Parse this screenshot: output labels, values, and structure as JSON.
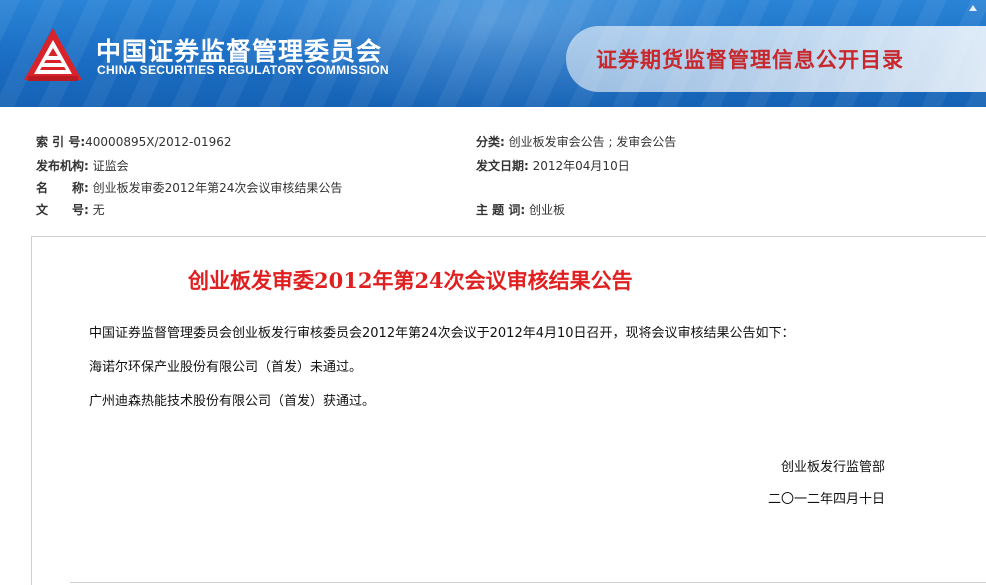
{
  "header": {
    "cn_title": "中国证券监督管理委员会",
    "en_title": "CHINA SECURITIES REGULATORY COMMISSION",
    "right_title": "证券期货监督管理信息公开目录",
    "logo": "csrc-logo-icon"
  },
  "meta": {
    "index_label": "索 引 号:",
    "index_value": "40000895X/2012-01962",
    "category_label": "分类:",
    "category_value": " 创业板发审会公告 ; 发审会公告",
    "issuer_label": "发布机构:",
    "issuer_value": " 证监会",
    "date_label": "发文日期:",
    "date_value": " 2012年04月10日",
    "name_label": "名　　称:",
    "name_value": " 创业板发审委2012年第24次会议审核结果公告",
    "docno_label": "文　　号:",
    "docno_value": " 无",
    "keyword_label": "主 题 词:",
    "keyword_value": " 创业板"
  },
  "document": {
    "title": "创业板发审委2012年第24次会议审核结果公告",
    "paragraphs": [
      "中国证券监督管理委员会创业板发行审核委员会2012年第24次会议于2012年4月10日召开，现将会议审核结果公告如下：",
      "海诺尔环保产业股份有限公司（首发）未通过。",
      "广州迪森热能技术股份有限公司（首发）获通过。"
    ],
    "signature_dept": "创业板发行监管部",
    "signature_date": "二〇一二年四月十日"
  },
  "colors": {
    "header_blue": "#1a6dc3",
    "title_red": "#e02020",
    "right_title_red": "#c8282c"
  }
}
